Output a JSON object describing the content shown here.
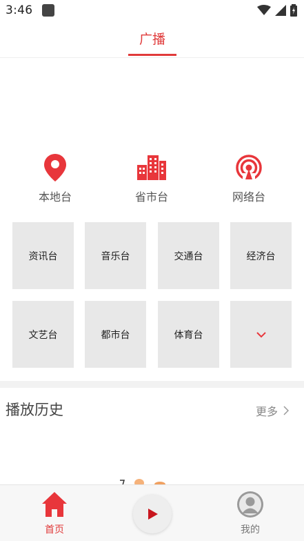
{
  "status": {
    "time": "3:46"
  },
  "header": {
    "tab_label": "广播"
  },
  "categories": [
    {
      "label": "本地台",
      "icon": "location-pin-icon"
    },
    {
      "label": "省市台",
      "icon": "buildings-icon"
    },
    {
      "label": "网络台",
      "icon": "broadcast-icon"
    }
  ],
  "stations": [
    {
      "label": "资讯台"
    },
    {
      "label": "音乐台"
    },
    {
      "label": "交通台"
    },
    {
      "label": "经济台"
    },
    {
      "label": "文艺台"
    },
    {
      "label": "都市台"
    },
    {
      "label": "体育台"
    }
  ],
  "expand_icon": "chevron-down-icon",
  "history": {
    "title": "播放历史",
    "more_label": "更多"
  },
  "bottom_nav": {
    "home_label": "首页",
    "mine_label": "我的"
  },
  "colors": {
    "accent": "#e03a3a",
    "cell_bg": "#e8e8e8"
  }
}
